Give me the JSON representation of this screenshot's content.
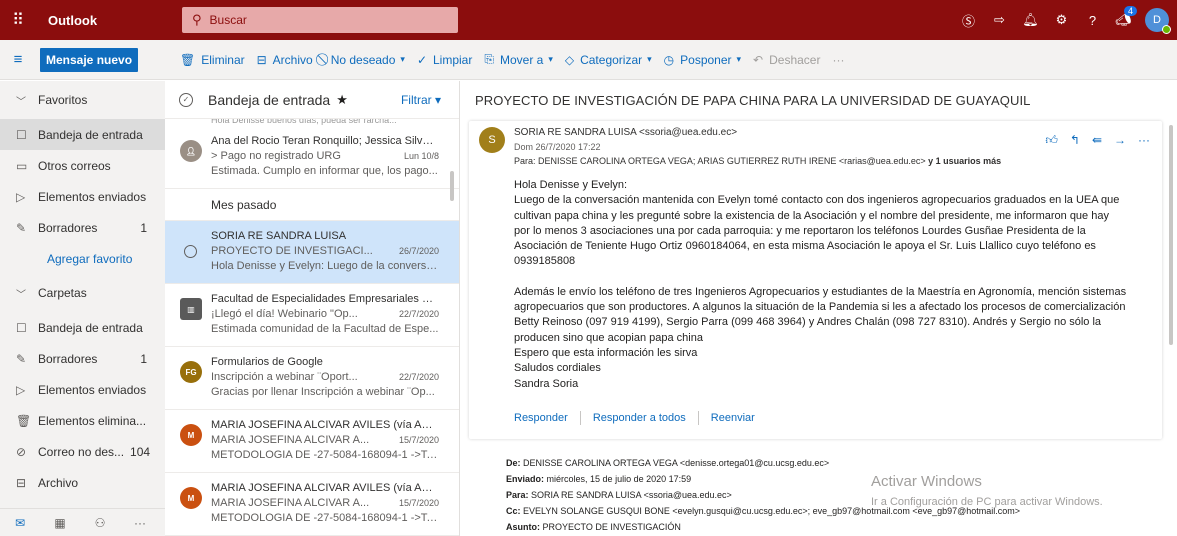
{
  "app": {
    "name": "Outlook",
    "search_placeholder": "Buscar",
    "notification_count": "4",
    "user_initials": "D"
  },
  "colors": {
    "topbar": "#8b0d0d",
    "accent": "#0f6cbd",
    "selected_message": "#cfe4fa"
  },
  "commands": {
    "new_message": "Mensaje nuevo",
    "delete": "Eliminar",
    "archive": "Archivo",
    "junk": "No deseado",
    "sweep": "Limpiar",
    "move": "Mover a",
    "categorize": "Categorizar",
    "snooze": "Posponer",
    "undo": "Deshacer",
    "more": "···"
  },
  "nav": {
    "favorites": "Favoritos",
    "inbox_fav": "Bandeja de entrada",
    "other": "Otros correos",
    "sent_fav": "Elementos enviados",
    "drafts_fav": "Borradores",
    "drafts_fav_count": "1",
    "add_favorite": "Agregar favorito",
    "folders": "Carpetas",
    "inbox": "Bandeja de entrada",
    "drafts": "Borradores",
    "drafts_count": "1",
    "sent": "Elementos enviados",
    "deleted": "Elementos elimina...",
    "junk": "Correo no des...",
    "junk_count": "104",
    "archive": "Archivo"
  },
  "list": {
    "title": "Bandeja de entrada",
    "filter": "Filtrar",
    "partial_top": "Hola Denisse buenos días, pueda ser rarcha...",
    "group_last_month": "Mes pasado",
    "messages": [
      {
        "sender": "Ana del Rocio Teran Ronquillo; Jessica Silvan...",
        "subject": "> Pago no registrado URG",
        "date": "Lun 10/8",
        "preview": "Estimada. Cumplo en informar que, los pago..."
      },
      {
        "sender": "SORIA RE SANDRA LUISA",
        "subject": "PROYECTO DE INVESTIGACI...",
        "date": "26/7/2020",
        "preview": "Hola Denisse y Evelyn: Luego de la conversa..."
      },
      {
        "sender": "Facultad de Especialidades Empresariales UC...",
        "subject": "¡Llegó el día! Webinario \"Op...",
        "date": "22/7/2020",
        "preview": "Estimada comunidad de la Facultad de Espe..."
      },
      {
        "initials": "FG",
        "sender": "Formularios de Google",
        "subject": "Inscripción a webinar ¨Oport...",
        "date": "22/7/2020",
        "preview": "Gracias por llenar Inscripción a webinar ¨Op..."
      },
      {
        "initials": "M",
        "sender": "MARIA JOSEFINA ALCIVAR AVILES (vía AULA...",
        "subject": "MARIA JOSEFINA ALCIVAR A...",
        "date": "15/7/2020",
        "preview": "METODOLOGIA DE -27-5084-168094-1 ->Ta..."
      },
      {
        "initials": "M",
        "sender": "MARIA JOSEFINA ALCIVAR AVILES (vía AULA...",
        "subject": "MARIA JOSEFINA ALCIVAR A...",
        "date": "15/7/2020",
        "preview": "METODOLOGIA DE -27-5084-168094-1 ->Ta..."
      }
    ]
  },
  "reading": {
    "subject": "PROYECTO DE INVESTIGACIÓN DE PAPA CHINA PARA LA UNIVERSIDAD DE GUAYAQUIL",
    "sender_initial": "S",
    "from": "SORIA RE SANDRA LUISA <ssoria@uea.edu.ec>",
    "date": "Dom 26/7/2020 17:22",
    "to_prefix": "Para:  DENISSE CAROLINA ORTEGA VEGA; ARIAS GUTIERREZ RUTH IRENE <rarias@uea.edu.ec>",
    "to_more": "y 1 usuarios más",
    "body": [
      "Hola Denisse y Evelyn:",
      "Luego de la conversación mantenida con Evelyn tomé contacto con dos ingenieros agropecuarios graduados en la UEA que",
      "cultivan papa china y les pregunté sobre la existencia de la Asociación y el nombre del presidente, me informaron que hay",
      "por lo menos 3 asociaciones una por cada parroquia: y  me reportaron los teléfonos Lourdes Gusñae Presidenta de la",
      "Asociación de Teniente Hugo Ortiz  0960184064, en esta misma Asociación le apoya el Sr. Luis Llallico cuyo teléfono es",
      "0939185808",
      "",
      "Además le envío los teléfono de tres Ingenieros Agropecuarios y estudiantes de la Maestría en Agronomía, mención sistemas",
      "agropecuarios que son productores. A algunos la situación de la Pandemia si les a afectado los procesos de comercialización",
      "Betty Reinoso (097 919 4199), Sergio Parra (099 468 3964) y Andres Chalán (098 727 8310). Andrés y Sergio no sólo la",
      "producen sino que acopian papa china",
      "Espero que esta información les sirva",
      "Saludos cordiales",
      "Sandra Soria"
    ],
    "reply": "Responder",
    "reply_all": "Responder a todos",
    "forward": "Reenviar",
    "fwd_de_label": "De:",
    "fwd_de": "DENISSE CAROLINA ORTEGA VEGA <denisse.ortega01@cu.ucsg.edu.ec>",
    "fwd_enviado_label": "Enviado:",
    "fwd_enviado": "miércoles, 15 de julio de 2020 17:59",
    "fwd_para_label": "Para:",
    "fwd_para": "SORIA RE SANDRA LUISA <ssoria@uea.edu.ec>",
    "fwd_cc_label": "Cc:",
    "fwd_cc": "EVELYN SOLANGE GUSQUI BONE <evelyn.gusqui@cu.ucsg.edu.ec>; eve_gb97@hotmail.com <eve_gb97@hotmail.com>",
    "fwd_asunto_label": "Asunto:",
    "fwd_asunto": "PROYECTO DE INVESTIGACIÓN"
  },
  "watermark": {
    "line1": "Activar Windows",
    "line2": "Ir a Configuración de PC para activar Windows."
  }
}
